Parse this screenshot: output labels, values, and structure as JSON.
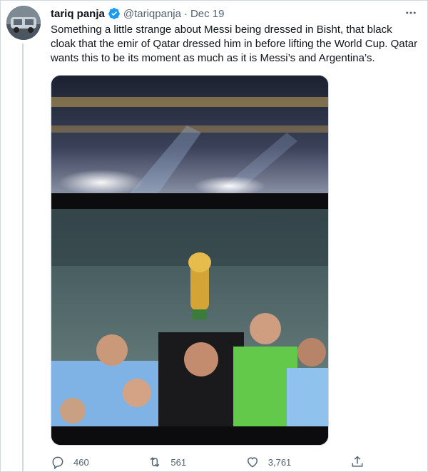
{
  "tweet": {
    "display_name": "tariq panja",
    "handle": "@tariqpanja",
    "separator": "·",
    "date": "Dec 19",
    "text": "Something a little strange about Messi being dressed in Bisht, that black cloak that the emir of Qatar dressed him in before lifting the World Cup. Qatar wants this to be its moment as much as it is Messi’s and Argentina’s."
  },
  "icons": {
    "verified": "verified-badge-icon",
    "more": "more-options-icon",
    "reply": "reply-icon",
    "retweet": "retweet-icon",
    "like": "like-icon",
    "share": "share-icon"
  },
  "actions": {
    "replies": "460",
    "retweets": "561",
    "likes": "3,761"
  },
  "colors": {
    "accent": "#1d9bf0",
    "text": "#0f1419",
    "secondary": "#536471",
    "border": "#cfd9de"
  }
}
